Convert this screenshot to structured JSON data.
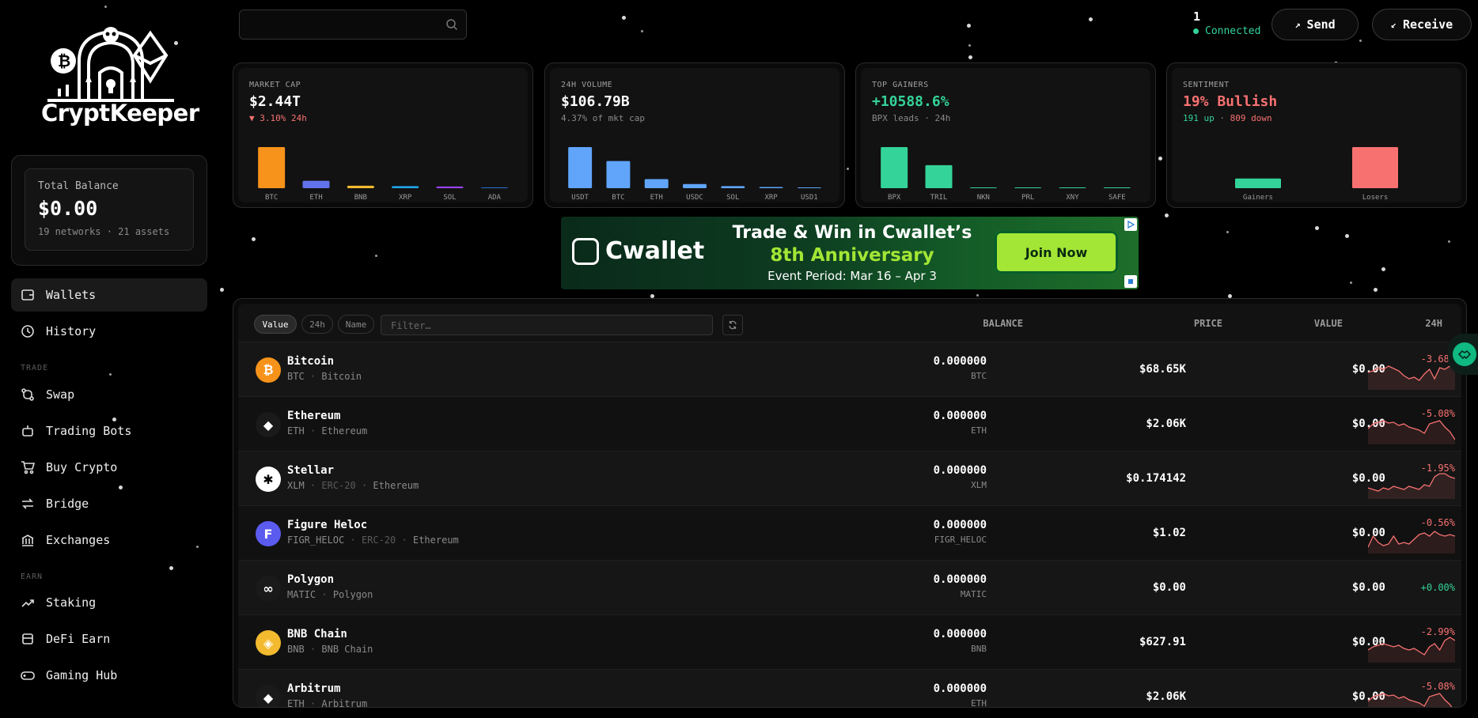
{
  "app": {
    "brand": "CryptKeeper"
  },
  "balance": {
    "label": "Total Balance",
    "value": "$0.00",
    "sub": "19 networks · 21 assets"
  },
  "nav": {
    "main": [
      {
        "label": "Wallets",
        "icon": "wallet-icon",
        "active": true
      },
      {
        "label": "History",
        "icon": "history-icon",
        "active": false
      }
    ],
    "trade_section": "TRADE",
    "trade": [
      {
        "label": "Swap",
        "icon": "swap-icon"
      },
      {
        "label": "Trading Bots",
        "icon": "bot-icon"
      },
      {
        "label": "Buy Crypto",
        "icon": "cart-icon"
      },
      {
        "label": "Bridge",
        "icon": "bridge-icon"
      },
      {
        "label": "Exchanges",
        "icon": "bank-icon"
      }
    ],
    "earn_section": "EARN",
    "earn": [
      {
        "label": "Staking",
        "icon": "trend-up-icon"
      },
      {
        "label": "DeFi Earn",
        "icon": "layers-icon"
      },
      {
        "label": "Gaming Hub",
        "icon": "gamepad-icon"
      }
    ]
  },
  "topbar": {
    "search_placeholder": "",
    "connected_count": "1",
    "connected_label": "Connected",
    "send_label": "Send",
    "receive_label": "Receive"
  },
  "stats": {
    "market_cap": {
      "label": "MARKET CAP",
      "value": "$2.44T",
      "sub": "3.10% 24h"
    },
    "volume": {
      "label": "24H VOLUME",
      "value": "$106.79B",
      "sub": "4.37% of mkt cap"
    },
    "gainers": {
      "label": "TOP GAINERS",
      "value": "+10588.6%",
      "sub": "BPX leads · 24h"
    },
    "sentiment": {
      "label": "SENTIMENT",
      "value": "19% Bullish",
      "sub_up": "191 up",
      "sub_sep": " · ",
      "sub_down": "809 down"
    }
  },
  "ad": {
    "brand": "Cwallet",
    "headline": "Trade & Win in Cwallet’s",
    "subheadline": "8th Anniversary",
    "period": "Event Period: Mar 16 – Apr 3",
    "cta": "Join Now"
  },
  "table": {
    "sort_buttons": [
      "Value",
      "24h",
      "Name"
    ],
    "filter_placeholder": "Filter…",
    "headers": {
      "balance": "BALANCE",
      "price": "PRICE",
      "value": "VALUE",
      "change": "24H"
    },
    "rows": [
      {
        "name": "Bitcoin",
        "sym": "BTC",
        "chain": "Bitcoin",
        "std": "",
        "balance": "0.000000",
        "unit": "BTC",
        "price": "$68.65K",
        "value": "$0.00",
        "change": "-3.68%",
        "icon_color": "#f7931a",
        "icon_glyph": "₿",
        "spark": [
          14,
          12,
          8,
          10,
          6,
          9,
          12,
          18,
          22,
          20,
          24,
          16,
          10,
          22,
          8,
          10,
          6,
          12
        ]
      },
      {
        "name": "Ethereum",
        "sym": "ETH",
        "chain": "Ethereum",
        "std": "",
        "balance": "0.000000",
        "unit": "ETH",
        "price": "$2.06K",
        "value": "$0.00",
        "change": "-5.08%",
        "icon_color": "#1a1a1a",
        "icon_glyph": "◆",
        "spark": [
          16,
          10,
          8,
          6,
          9,
          8,
          12,
          10,
          14,
          16,
          18,
          22,
          10,
          8,
          6,
          14,
          20,
          30
        ]
      },
      {
        "name": "Stellar",
        "sym": "XLM",
        "chain": "Ethereum",
        "std": "ERC-20",
        "balance": "0.000000",
        "unit": "XLM",
        "price": "$0.174142",
        "value": "$0.00",
        "change": "-1.95%",
        "icon_color": "#ffffff",
        "icon_glyph": "✱",
        "spark": [
          22,
          24,
          26,
          22,
          24,
          20,
          22,
          24,
          20,
          22,
          24,
          18,
          20,
          8,
          4,
          4,
          8,
          10
        ]
      },
      {
        "name": "Figure Heloc",
        "sym": "FIGR_HELOC",
        "chain": "Ethereum",
        "std": "ERC-20",
        "balance": "0.000000",
        "unit": "FIGR_HELOC",
        "price": "$1.02",
        "value": "$0.00",
        "change": "-0.56%",
        "icon_color": "#5b5bf0",
        "icon_glyph": "F",
        "spark": [
          28,
          14,
          22,
          26,
          24,
          14,
          24,
          22,
          24,
          18,
          12,
          10,
          14,
          8,
          12,
          14,
          12,
          14
        ]
      },
      {
        "name": "Polygon",
        "sym": "MATIC",
        "chain": "Polygon",
        "std": "",
        "balance": "0.000000",
        "unit": "MATIC",
        "price": "$0.00",
        "value": "$0.00",
        "change": "+0.00%",
        "icon_color": "#1a1a1a",
        "icon_glyph": "∞",
        "spark": []
      },
      {
        "name": "BNB Chain",
        "sym": "BNB",
        "chain": "BNB Chain",
        "std": "",
        "balance": "0.000000",
        "unit": "BNB",
        "price": "$627.91",
        "value": "$0.00",
        "change": "-2.99%",
        "icon_color": "#f3ba2f",
        "icon_glyph": "◈",
        "spark": [
          20,
          16,
          14,
          12,
          14,
          16,
          14,
          18,
          20,
          18,
          22,
          26,
          16,
          12,
          20,
          8,
          4,
          8
        ]
      },
      {
        "name": "Arbitrum",
        "sym": "ETH",
        "chain": "Arbitrum",
        "std": "",
        "balance": "0.000000",
        "unit": "ETH",
        "price": "$2.06K",
        "value": "$0.00",
        "change": "-5.08%",
        "icon_color": "#1a1a1a",
        "icon_glyph": "◆",
        "spark": [
          16,
          10,
          8,
          6,
          9,
          8,
          12,
          10,
          14,
          16,
          18,
          22,
          10,
          8,
          6,
          14,
          20,
          30
        ]
      }
    ]
  },
  "chart_data": [
    {
      "type": "bar",
      "title": "MARKET CAP",
      "categories": [
        "BTC",
        "ETH",
        "BNB",
        "XRP",
        "SOL",
        "ADA"
      ],
      "values": [
        100,
        18,
        6,
        5,
        4,
        0
      ],
      "colors": [
        "#f7931a",
        "#6272ea",
        "#f3ba2f",
        "#1ea5e9",
        "#9945ff",
        "#2a71d0"
      ]
    },
    {
      "type": "bar",
      "title": "24H VOLUME",
      "categories": [
        "USDT",
        "BTC",
        "ETH",
        "USDC",
        "SOL",
        "XRP",
        "USD1"
      ],
      "values": [
        100,
        66,
        22,
        10,
        5,
        3,
        2
      ],
      "colors": [
        "#60a5fa",
        "#60a5fa",
        "#60a5fa",
        "#60a5fa",
        "#60a5fa",
        "#60a5fa",
        "#60a5fa"
      ]
    },
    {
      "type": "bar",
      "title": "TOP GAINERS",
      "categories": [
        "BPX",
        "TRIL",
        "NKN",
        "PRL",
        "XNY",
        "SAFE"
      ],
      "values": [
        100,
        56,
        2,
        1,
        1,
        1
      ],
      "colors": [
        "#34d399",
        "#34d399",
        "#34d399",
        "#34d399",
        "#34d399",
        "#34d399"
      ]
    },
    {
      "type": "bar",
      "title": "SENTIMENT",
      "categories": [
        "Gainers",
        "Losers"
      ],
      "values": [
        191,
        809
      ],
      "colors": [
        "#34d399",
        "#f87171"
      ]
    }
  ]
}
